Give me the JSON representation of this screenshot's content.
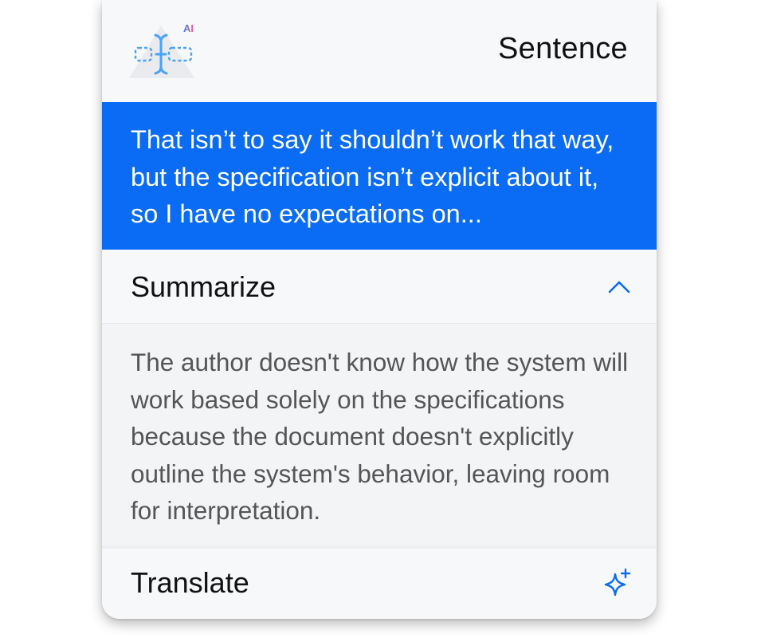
{
  "header": {
    "logo_badge": "AI",
    "title": "Sentence"
  },
  "selection": {
    "text": "That isn’t to say it shouldn’t work that way, but the specification isn’t explicit about it, so I have no expectations on..."
  },
  "summarize": {
    "label": "Summarize",
    "expanded": true,
    "toggle_icon": "chevron-up-icon",
    "result": "The author doesn't know how the system will work based solely on the specifications because the document doesn't explicitly outline the system's behavior, leaving room for interpretation."
  },
  "translate": {
    "label": "Translate",
    "action_icon": "sparkle-icon"
  },
  "colors": {
    "accent": "#0a6cf5",
    "selection_bg": "#0a6cf5",
    "card_bg": "#f6f7f9",
    "body_text": "#555555",
    "badge_gradient_start": "#3b7bf7",
    "badge_gradient_end": "#f05a8a"
  }
}
